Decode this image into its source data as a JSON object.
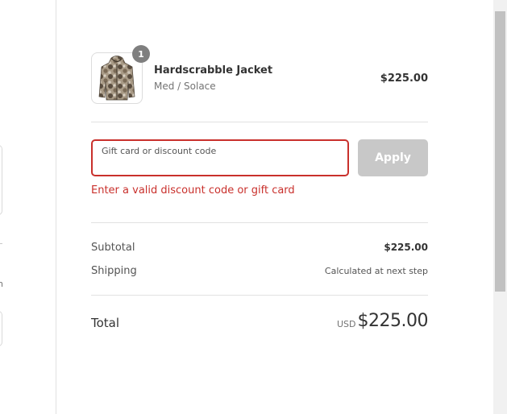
{
  "product": {
    "name": "Hardscrabble Jacket",
    "variant": "Med / Solace",
    "price": "$225.00",
    "quantity": "1",
    "image_icon": "camo-jacket-icon"
  },
  "discount": {
    "label": "Gift card or discount code",
    "value": "",
    "apply_label": "Apply",
    "error": "Enter a valid discount code or gift card"
  },
  "totals": {
    "subtotal_label": "Subtotal",
    "subtotal_value": "$225.00",
    "shipping_label": "Shipping",
    "shipping_value": "Calculated at next step",
    "total_label": "Total",
    "currency": "USD",
    "total_value": "$225.00"
  },
  "left_fragment": {
    "text": "n"
  },
  "colors": {
    "error": "#c9302c",
    "button_disabled": "#c8c8c8",
    "badge": "#7f7f7f"
  }
}
